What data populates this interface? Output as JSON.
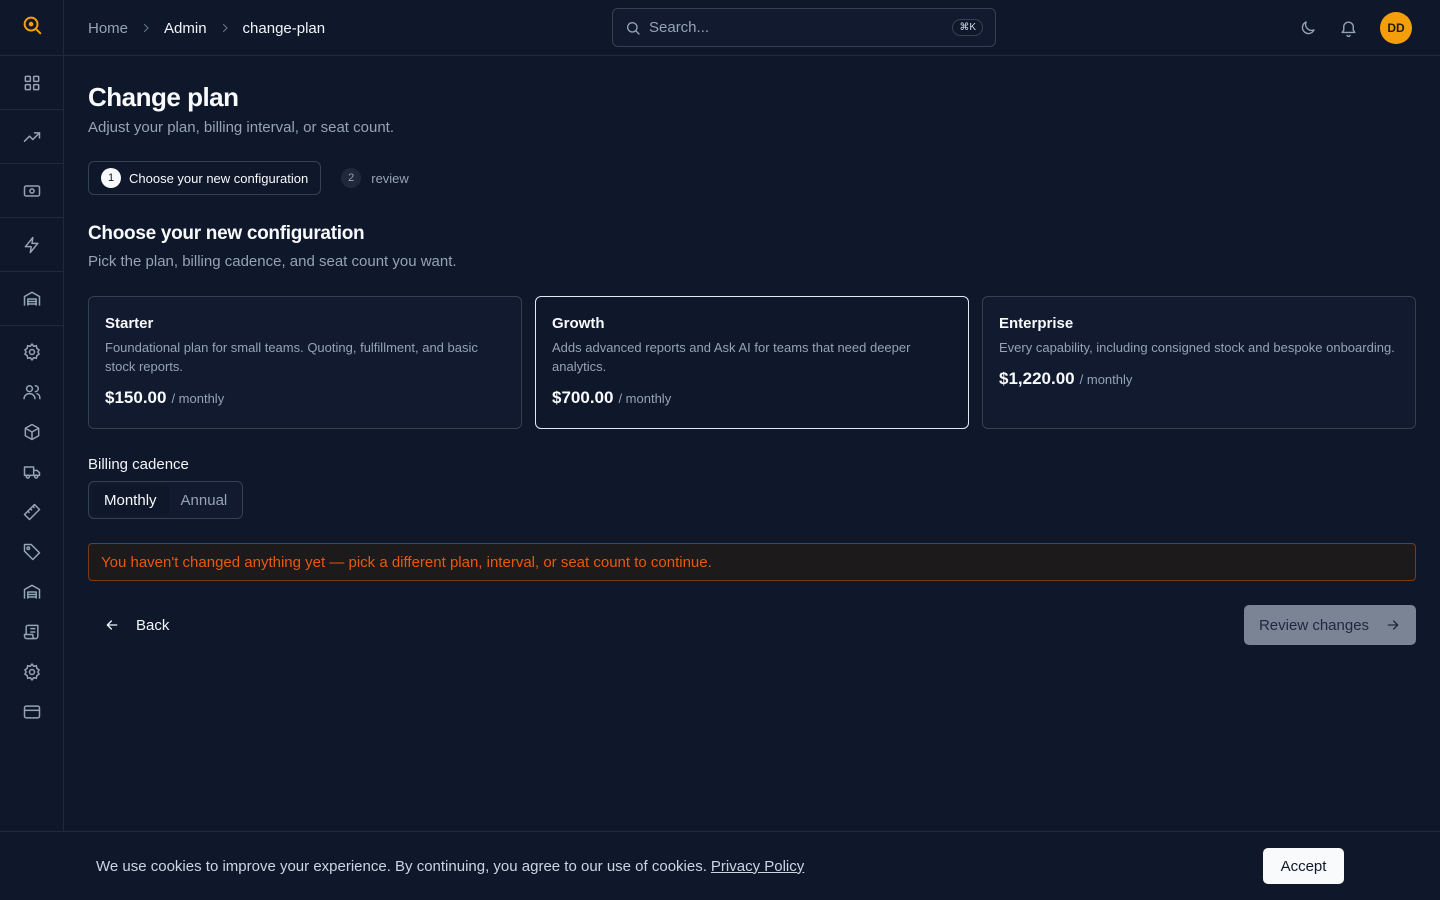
{
  "colors": {
    "background": "#0f172a",
    "accent": "#f59e0b",
    "warning_text": "#ea580c",
    "warning_border": "#7c3a12"
  },
  "sidebar": {
    "logo_icon": "search-logo-icon",
    "items": [
      {
        "icon": "dashboard-grid-icon"
      },
      {
        "icon": "trending-up-icon"
      },
      {
        "icon": "banknote-icon"
      },
      {
        "icon": "lightning-bolt-icon"
      },
      {
        "icon": "warehouse-icon"
      },
      {
        "icon": "gear-icon"
      },
      {
        "icon": "users-icon"
      },
      {
        "icon": "package-box-icon"
      },
      {
        "icon": "truck-icon"
      },
      {
        "icon": "ruler-icon"
      },
      {
        "icon": "tag-icon"
      },
      {
        "icon": "warehouse-icon"
      },
      {
        "icon": "scroll-icon"
      },
      {
        "icon": "gear-icon"
      },
      {
        "icon": "credit-card-icon"
      }
    ]
  },
  "header": {
    "breadcrumb": [
      "Home",
      "Admin",
      "change-plan"
    ],
    "search_placeholder": "Search...",
    "search_shortcut": "⌘K",
    "avatar_initials": "DD"
  },
  "main": {
    "title": "Change plan",
    "subtitle": "Adjust your plan, billing interval, or seat count.",
    "steps": [
      {
        "num": "1",
        "label": "Choose your new configuration"
      },
      {
        "num": "2",
        "label": "review"
      }
    ],
    "section_title": "Choose your new configuration",
    "section_subtitle": "Pick the plan, billing cadence, and seat count you want.",
    "plans": [
      {
        "name": "Starter",
        "description": "Foundational plan for small teams. Quoting, fulfillment, and basic stock reports.",
        "price": "$150.00",
        "period": "/ monthly",
        "selected": false
      },
      {
        "name": "Growth",
        "description": "Adds advanced reports and Ask AI for teams that need deeper analytics.",
        "price": "$700.00",
        "period": "/ monthly",
        "selected": true
      },
      {
        "name": "Enterprise",
        "description": "Every capability, including consigned stock and bespoke onboarding.",
        "price": "$1,220.00",
        "period": "/ monthly",
        "selected": false
      }
    ],
    "cadence_label": "Billing cadence",
    "cadence_options": [
      "Monthly",
      "Annual"
    ],
    "cadence_selected": "Monthly",
    "warning": "You haven't changed anything yet — pick a different plan, interval, or seat count to continue.",
    "back_label": "Back",
    "review_label": "Review changes"
  },
  "cookie": {
    "text": "We use cookies to improve your experience. By continuing, you agree to our use of cookies.",
    "link": "Privacy Policy",
    "accept": "Accept"
  }
}
